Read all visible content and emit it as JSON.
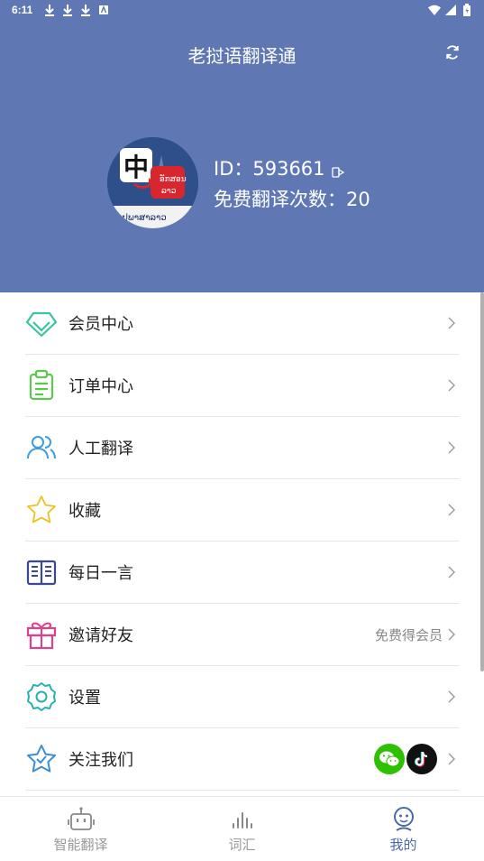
{
  "status_bar": {
    "time": "6:11"
  },
  "header": {
    "title": "老挝语翻译通"
  },
  "profile": {
    "id_text": "ID：593661",
    "free_count_text": "免费翻译次数：20",
    "avatar_char": "中"
  },
  "menu": [
    {
      "label": "会员中心",
      "icon": "diamond-icon",
      "color": "#3cc4a0"
    },
    {
      "label": "订单中心",
      "icon": "clipboard-icon",
      "color": "#5cc850"
    },
    {
      "label": "人工翻译",
      "icon": "users-icon",
      "color": "#3b9fd8"
    },
    {
      "label": "收藏",
      "icon": "star-icon",
      "color": "#f0c020"
    },
    {
      "label": "每日一言",
      "icon": "book-icon",
      "color": "#3a4a8c"
    },
    {
      "label": "邀请好友",
      "icon": "gift-icon",
      "color": "#e0408a",
      "extra": "免费得会员"
    },
    {
      "label": "设置",
      "icon": "gear-icon",
      "color": "#26b0b0"
    },
    {
      "label": "关注我们",
      "icon": "star-check-icon",
      "color": "#3b8fd0"
    }
  ],
  "tabs": [
    {
      "label": "智能翻译",
      "icon": "robot-icon",
      "active": false
    },
    {
      "label": "词汇",
      "icon": "bars-icon",
      "active": false
    },
    {
      "label": "我的",
      "icon": "user-face-icon",
      "active": true
    }
  ],
  "colors": {
    "header_bg": "#5f78b4",
    "active_tab": "#4a6aa8"
  }
}
